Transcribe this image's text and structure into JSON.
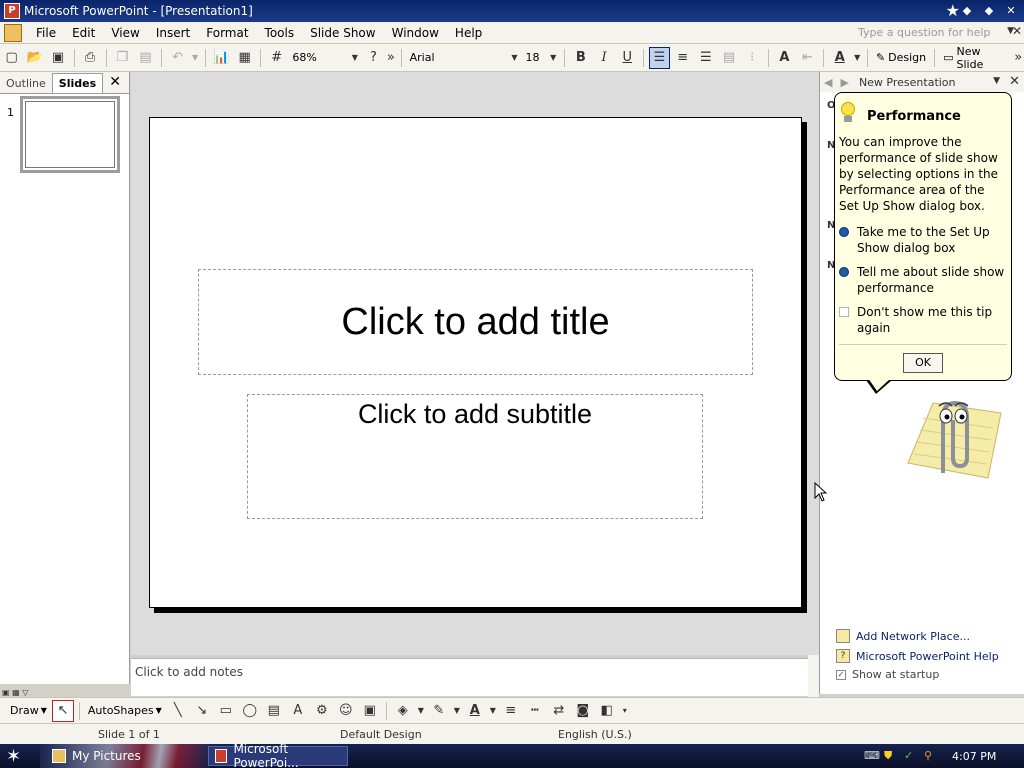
{
  "window": {
    "title": "Microsoft PowerPoint - [Presentation1]",
    "close": "✕"
  },
  "menubar": {
    "items": [
      {
        "label": "File"
      },
      {
        "label": "Edit"
      },
      {
        "label": "View"
      },
      {
        "label": "Insert"
      },
      {
        "label": "Format"
      },
      {
        "label": "Tools"
      },
      {
        "label": "Slide Show"
      },
      {
        "label": "Window"
      },
      {
        "label": "Help"
      }
    ],
    "help_placeholder": "Type a question for help"
  },
  "toolbar": {
    "zoom": "68%",
    "font_name": "Arial",
    "font_size": "18",
    "design_label": "Design",
    "new_slide_label": "New Slide"
  },
  "left_pane": {
    "tabs": [
      {
        "label": "Outline"
      },
      {
        "label": "Slides"
      }
    ],
    "slide_number": "1"
  },
  "slide": {
    "title_placeholder": "Click to add title",
    "subtitle_placeholder": "Click to add subtitle"
  },
  "notes": {
    "placeholder": "Click to add notes"
  },
  "task_pane": {
    "title": "New Presentation",
    "edge_letters": [
      "O",
      "N",
      "N",
      "N"
    ],
    "links": [
      {
        "label": "Add Network Place..."
      },
      {
        "label": "Microsoft PowerPoint Help"
      }
    ],
    "show_at_startup": "Show at startup"
  },
  "balloon": {
    "title": "Performance",
    "body": "You can improve the performance of slide show by selecting options in the Performance area of the Set Up Show dialog box.",
    "options": [
      {
        "label": "Take me to the Set Up Show dialog box"
      },
      {
        "label": "Tell me about slide show performance"
      }
    ],
    "checkbox_label": "Don't show me this tip again",
    "ok_label": "OK"
  },
  "drawbar": {
    "draw_label": "Draw",
    "autoshapes_label": "AutoShapes"
  },
  "statusbar": {
    "slide_info": "Slide 1 of 1",
    "design": "Default Design",
    "language": "English (U.S.)"
  },
  "taskbar": {
    "task1": "My Pictures",
    "task2": "Microsoft PowerPoi...",
    "time": "4:07 PM"
  },
  "colors": {
    "titlebar": "#0a246a",
    "balloon": "#ffffe1",
    "link": "#0a246a"
  }
}
